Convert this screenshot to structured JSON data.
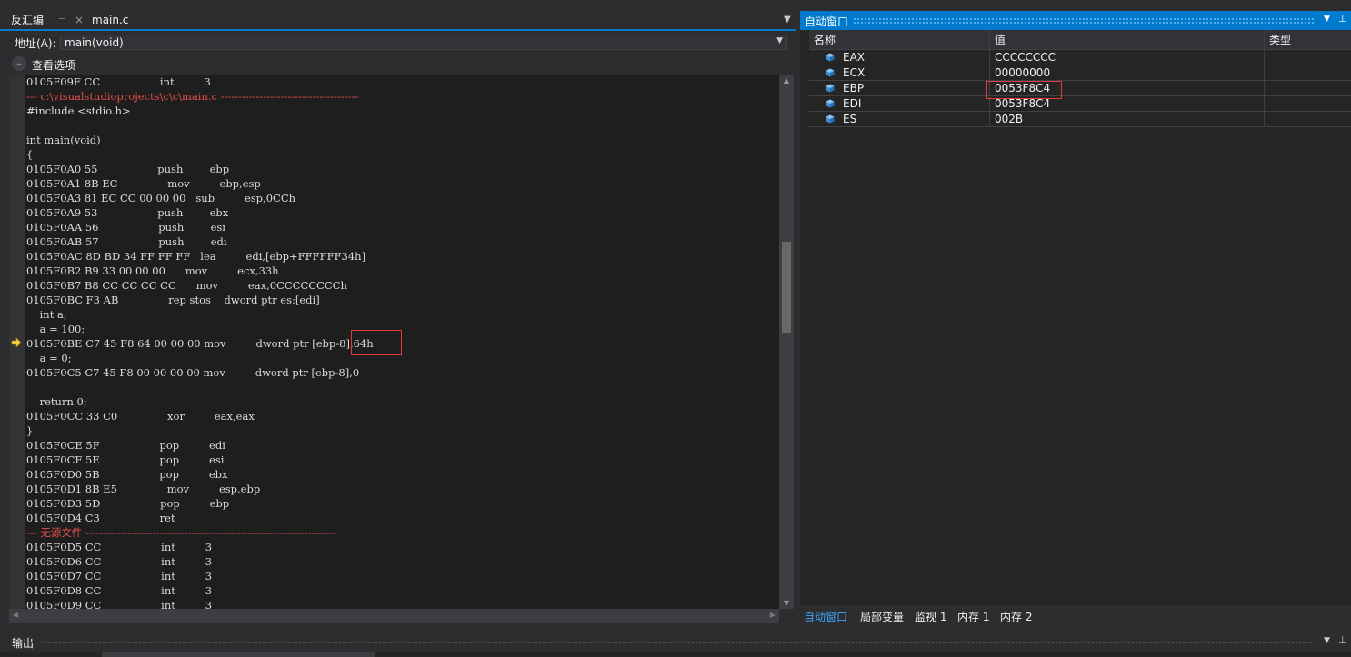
{
  "disasm_tabs": {
    "active": "反汇编",
    "pin": "⊣",
    "close": "×",
    "secondary": "main.c",
    "overflow": "▼"
  },
  "address_bar": {
    "label": "地址(A):",
    "value": "main(void)",
    "dropdown": "▼"
  },
  "view_options": {
    "label": "查看选项",
    "chevron": "⌄"
  },
  "code_lines": [
    {
      "text": "0105F09F CC                  int         3",
      "style": "normal"
    },
    {
      "text": "--- c:\\visualstudioprojects\\c\\c\\main.c ---------------------------------------",
      "style": "red"
    },
    {
      "text": "#include <stdio.h>",
      "style": "normal"
    },
    {
      "text": "",
      "style": "normal"
    },
    {
      "text": "int main(void)",
      "style": "normal"
    },
    {
      "text": "{",
      "style": "normal"
    },
    {
      "text": "0105F0A0 55                  push        ebp",
      "style": "normal"
    },
    {
      "text": "0105F0A1 8B EC               mov         ebp,esp",
      "style": "normal"
    },
    {
      "text": "0105F0A3 81 EC CC 00 00 00   sub         esp,0CCh",
      "style": "normal"
    },
    {
      "text": "0105F0A9 53                  push        ebx",
      "style": "normal"
    },
    {
      "text": "0105F0AA 56                  push        esi",
      "style": "normal"
    },
    {
      "text": "0105F0AB 57                  push        edi",
      "style": "normal"
    },
    {
      "text": "0105F0AC 8D BD 34 FF FF FF   lea         edi,[ebp+FFFFFF34h]",
      "style": "normal"
    },
    {
      "text": "0105F0B2 B9 33 00 00 00      mov         ecx,33h",
      "style": "normal"
    },
    {
      "text": "0105F0B7 B8 CC CC CC CC      mov         eax,0CCCCCCCCh",
      "style": "normal"
    },
    {
      "text": "0105F0BC F3 AB               rep stos    dword ptr es:[edi]",
      "style": "normal"
    },
    {
      "text": "    int a;",
      "style": "normal"
    },
    {
      "text": "    a = 100;",
      "style": "normal"
    },
    {
      "text": "0105F0BE C7 45 F8 64 00 00 00 mov         dword ptr [ebp-8],64h",
      "style": "normal"
    },
    {
      "text": "    a = 0;",
      "style": "normal"
    },
    {
      "text": "0105F0C5 C7 45 F8 00 00 00 00 mov         dword ptr [ebp-8],0",
      "style": "normal"
    },
    {
      "text": "",
      "style": "normal"
    },
    {
      "text": "    return 0;",
      "style": "normal"
    },
    {
      "text": "0105F0CC 33 C0               xor         eax,eax",
      "style": "normal"
    },
    {
      "text": "}",
      "style": "normal"
    },
    {
      "text": "0105F0CE 5F                  pop         edi",
      "style": "normal"
    },
    {
      "text": "0105F0CF 5E                  pop         esi",
      "style": "normal"
    },
    {
      "text": "0105F0D0 5B                  pop         ebx",
      "style": "normal"
    },
    {
      "text": "0105F0D1 8B E5               mov         esp,ebp",
      "style": "normal"
    },
    {
      "text": "0105F0D3 5D                  pop         ebp",
      "style": "normal"
    },
    {
      "text": "0105F0D4 C3                  ret",
      "style": "normal"
    },
    {
      "text": "--- 无源文件 -----------------------------------------------------------------------",
      "style": "red"
    },
    {
      "text": "0105F0D5 CC                  int         3",
      "style": "normal"
    },
    {
      "text": "0105F0D6 CC                  int         3",
      "style": "normal"
    },
    {
      "text": "0105F0D7 CC                  int         3",
      "style": "normal"
    },
    {
      "text": "0105F0D8 CC                  int         3",
      "style": "normal"
    },
    {
      "text": "0105F0D9 CC                  int         3",
      "style": "normal"
    }
  ],
  "scroll_icons": {
    "up": "▲",
    "down": "▼",
    "left": "◀",
    "right": "▶"
  },
  "autos": {
    "title": "自动窗口",
    "dropdown": "▼",
    "pin": "⊥",
    "columns": {
      "name": "名称",
      "value": "值",
      "type": "类型"
    },
    "rows": [
      {
        "name": "EAX",
        "value": "CCCCCCCC",
        "type": ""
      },
      {
        "name": "ECX",
        "value": "00000000",
        "type": ""
      },
      {
        "name": "EBP",
        "value": "0053F8C4",
        "type": ""
      },
      {
        "name": "EDI",
        "value": "0053F8C4",
        "type": ""
      },
      {
        "name": "ES",
        "value": "002B",
        "type": ""
      }
    ],
    "bottom_tabs": [
      "自动窗口",
      "局部变量",
      "监视 1",
      "内存 1",
      "内存 2"
    ]
  },
  "output": {
    "title": "输出",
    "dropdown": "▼",
    "pin": "⊥"
  },
  "colors": {
    "accent": "#007acc",
    "highlight_box": "#e03c3c",
    "red_text": "#e6504a",
    "ip_arrow": "#f5d23a",
    "register_icon": "#3c8fd9"
  },
  "icons": {
    "instruction_pointer": "ip-arrow-icon",
    "register": "register-cube-icon"
  }
}
